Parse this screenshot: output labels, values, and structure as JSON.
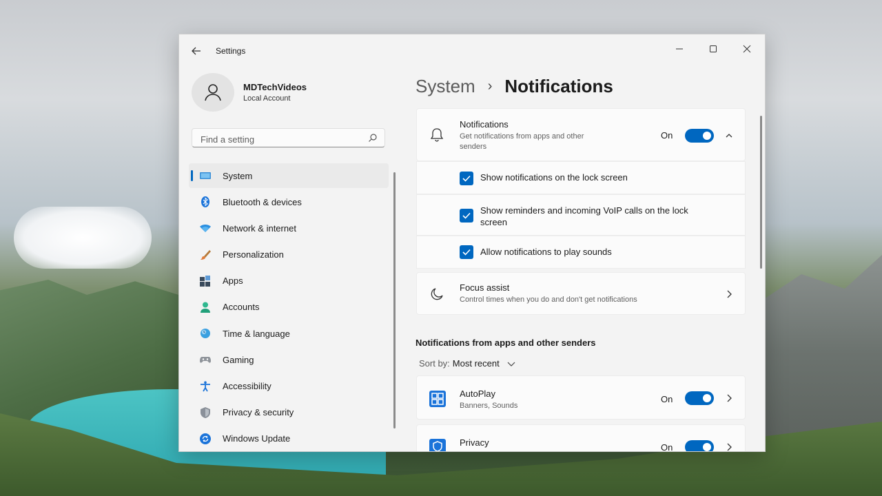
{
  "window": {
    "title": "Settings"
  },
  "profile": {
    "name": "MDTechVideos",
    "account_type": "Local Account"
  },
  "search": {
    "placeholder": "Find a setting"
  },
  "nav": {
    "items": [
      {
        "label": "System",
        "icon": "system-icon",
        "active": true
      },
      {
        "label": "Bluetooth & devices",
        "icon": "bluetooth-icon"
      },
      {
        "label": "Network & internet",
        "icon": "wifi-icon"
      },
      {
        "label": "Personalization",
        "icon": "brush-icon"
      },
      {
        "label": "Apps",
        "icon": "apps-icon"
      },
      {
        "label": "Accounts",
        "icon": "person-icon"
      },
      {
        "label": "Time & language",
        "icon": "globe-clock-icon"
      },
      {
        "label": "Gaming",
        "icon": "gamepad-icon"
      },
      {
        "label": "Accessibility",
        "icon": "accessibility-icon"
      },
      {
        "label": "Privacy & security",
        "icon": "shield-icon"
      },
      {
        "label": "Windows Update",
        "icon": "update-icon"
      }
    ]
  },
  "breadcrumb": {
    "parent": "System",
    "separator": "›",
    "current": "Notifications"
  },
  "notifications": {
    "title": "Notifications",
    "subtitle": "Get notifications from apps and other senders",
    "state": "On",
    "options": [
      {
        "label": "Show notifications on the lock screen",
        "checked": true
      },
      {
        "label": "Show reminders and incoming VoIP calls on the lock screen",
        "checked": true
      },
      {
        "label": "Allow notifications to play sounds",
        "checked": true
      }
    ]
  },
  "focus_assist": {
    "title": "Focus assist",
    "subtitle": "Control times when you do and don't get notifications"
  },
  "apps_section": {
    "title": "Notifications from apps and other senders",
    "sort_label": "Sort by:",
    "sort_value": "Most recent",
    "apps": [
      {
        "name": "AutoPlay",
        "detail": "Banners, Sounds",
        "state": "On",
        "icon": "autoplay-icon"
      },
      {
        "name": "Privacy",
        "detail": "",
        "state": "On",
        "icon": "privacy-shield-icon"
      }
    ]
  },
  "colors": {
    "accent": "#0067c0"
  }
}
